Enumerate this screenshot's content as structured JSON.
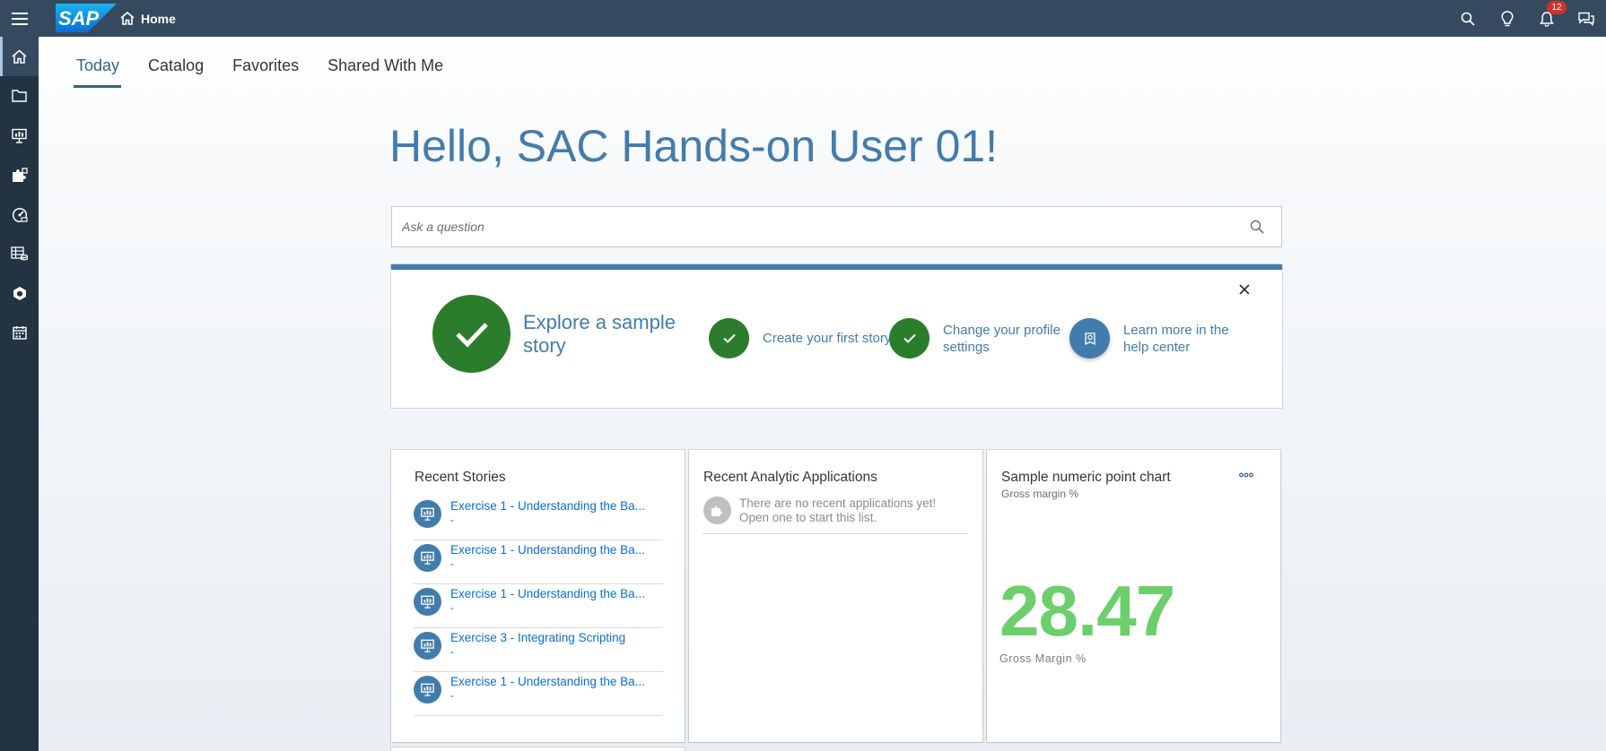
{
  "shell": {
    "home_label": "Home",
    "logo_text": "SAP",
    "notification_count": "12",
    "icons": [
      "menu-icon",
      "home-icon",
      "search-icon",
      "lightbulb-icon",
      "bell-icon",
      "feedback-icon"
    ]
  },
  "rail": {
    "items": [
      {
        "name": "home",
        "icon": "home-icon",
        "active": true
      },
      {
        "name": "files",
        "icon": "folder-icon"
      },
      {
        "name": "stories",
        "icon": "presentation-icon"
      },
      {
        "name": "analytic-applications",
        "icon": "puzzle-icon"
      },
      {
        "name": "digital-boardroom",
        "icon": "gauge-icon"
      },
      {
        "name": "modeler",
        "icon": "cube-table-icon"
      },
      {
        "name": "data-integration",
        "icon": "hexagon-icon"
      },
      {
        "name": "calendar",
        "icon": "calendar-icon"
      }
    ]
  },
  "tabs": [
    {
      "label": "Today",
      "active": true
    },
    {
      "label": "Catalog"
    },
    {
      "label": "Favorites"
    },
    {
      "label": "Shared With Me"
    }
  ],
  "greeting": "Hello, SAC Hands-on User 01!",
  "search": {
    "placeholder": "Ask a question"
  },
  "onboarding": {
    "steps": [
      {
        "label": "Explore a sample story",
        "done": true
      },
      {
        "label": "Create your first story",
        "done": true
      },
      {
        "label": "Change your profile settings",
        "done": true
      },
      {
        "label": "Learn more in the help center",
        "done": false
      }
    ]
  },
  "recent_stories": {
    "title": "Recent Stories",
    "items": [
      {
        "name": "Exercise 1 - Understanding the Ba...",
        "sub": "-"
      },
      {
        "name": "Exercise 1 - Understanding the Ba...",
        "sub": "-"
      },
      {
        "name": "Exercise 1 - Understanding the Ba...",
        "sub": "-"
      },
      {
        "name": "Exercise 3 - Integrating Scripting",
        "sub": "-"
      },
      {
        "name": "Exercise 1 - Understanding the Ba...",
        "sub": "-"
      }
    ]
  },
  "recent_apps": {
    "title": "Recent Analytic Applications",
    "empty_text": "There are no recent applications yet! Open one to start this list."
  },
  "kpi": {
    "title": "Sample numeric point chart",
    "subtitle": "Gross margin %",
    "value": "28.47",
    "label": "Gross Margin %",
    "value_color": "#6ccf6c"
  },
  "colors": {
    "shell": "#354a5f",
    "rail": "#233342",
    "accent": "#427cac",
    "success": "#2b7d2b",
    "link": "#0a6ed1"
  }
}
